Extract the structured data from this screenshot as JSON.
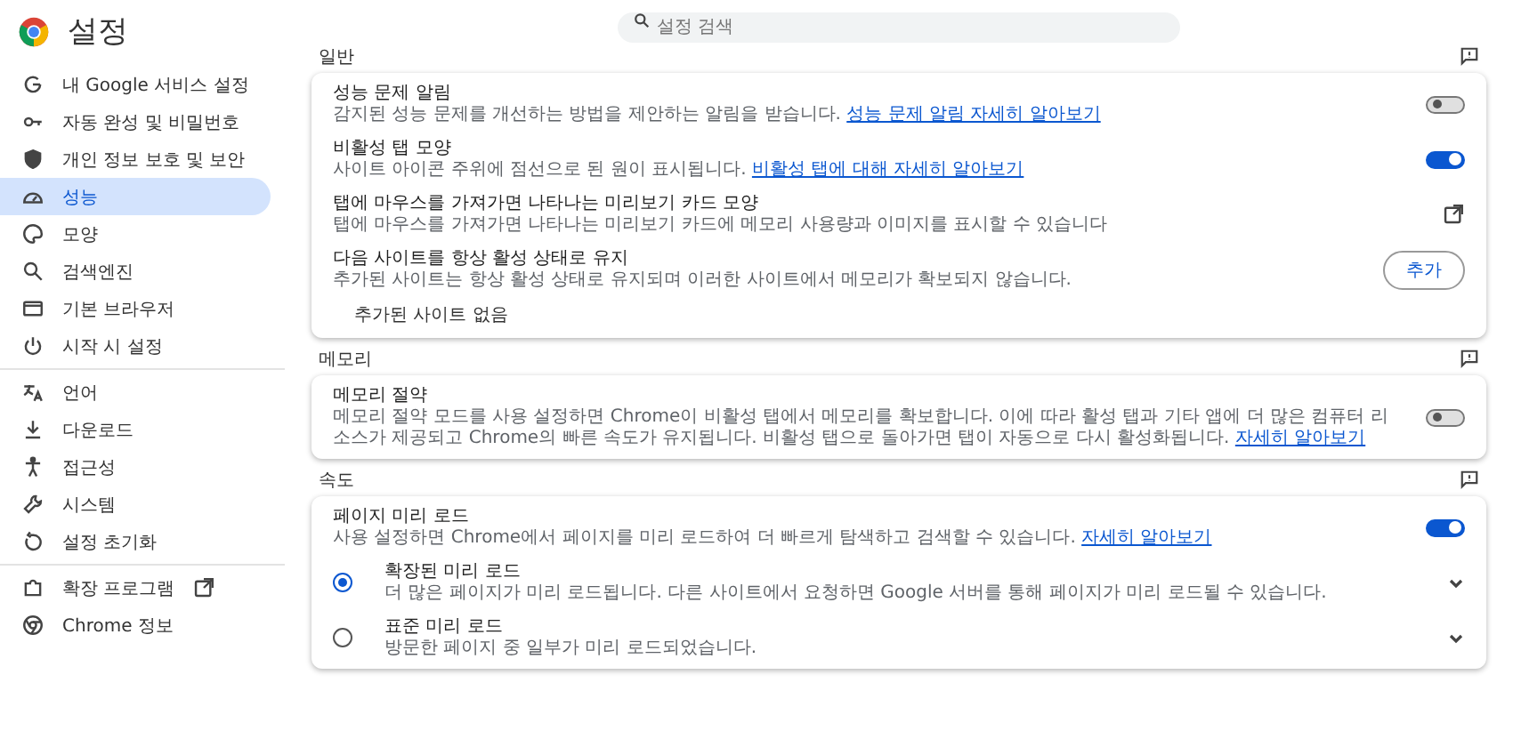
{
  "sidebar": {
    "title": "설정",
    "groups": [
      {
        "items": [
          {
            "label": "내 Google 서비스 설정",
            "selected": false
          },
          {
            "label": "자동 완성 및 비밀번호",
            "selected": false
          },
          {
            "label": "개인 정보 보호 및 보안",
            "selected": false
          },
          {
            "label": "성능",
            "selected": true
          },
          {
            "label": "모양",
            "selected": false
          },
          {
            "label": "검색엔진",
            "selected": false
          },
          {
            "label": "기본 브라우저",
            "selected": false
          },
          {
            "label": "시작 시 설정",
            "selected": false
          }
        ]
      },
      {
        "items": [
          {
            "label": "언어",
            "selected": false
          },
          {
            "label": "다운로드",
            "selected": false
          },
          {
            "label": "접근성",
            "selected": false
          },
          {
            "label": "시스템",
            "selected": false
          },
          {
            "label": "설정 초기화",
            "selected": false
          }
        ]
      },
      {
        "items": [
          {
            "label": "확장 프로그램",
            "selected": false,
            "external": true
          },
          {
            "label": "Chrome 정보",
            "selected": false
          }
        ]
      }
    ]
  },
  "search": {
    "placeholder": "설정 검색"
  },
  "sections": [
    {
      "title": "일반",
      "rows": [
        {
          "kind": "toggle",
          "title": "성능 문제 알림",
          "description": "감지된 성능 문제를 개선하는 방법을 제안하는 알림을 받습니다.",
          "link": "성능 문제 알림 자세히 알아보기",
          "on": false
        },
        {
          "kind": "toggle",
          "title": "비활성 탭 모양",
          "description": "사이트 아이콘 주위에 점선으로 된 원이 표시됩니다.",
          "link": "비활성 탭에 대해 자세히 알아보기",
          "on": true
        },
        {
          "kind": "external",
          "title": "탭에 마우스를 가져가면 나타나는 미리보기 카드 모양",
          "description": "탭에 마우스를 가져가면 나타나는 미리보기 카드에 메모리 사용량과 이미지를 표시할 수 있습니다"
        },
        {
          "kind": "button",
          "title": "다음 사이트를 항상 활성 상태로 유지",
          "description": "추가된 사이트는 항상 활성 상태로 유지되며 이러한 사이트에서 메모리가 확보되지 않습니다.",
          "button": "추가"
        },
        {
          "kind": "note",
          "title": "추가된 사이트 없음"
        }
      ]
    },
    {
      "title": "메모리",
      "rows": [
        {
          "kind": "toggle",
          "title": "메모리 절약",
          "description": "메모리 절약 모드를 사용 설정하면 Chrome이 비활성 탭에서 메모리를 확보합니다. 이에 따라 활성 탭과 기타 앱에 더 많은 컴퓨터 리소스가 제공되고 Chrome의 빠른 속도가 유지됩니다. 비활성 탭으로 돌아가면 탭이 자동으로 다시 활성화됩니다.",
          "link": "자세히 알아보기",
          "on": false
        }
      ]
    },
    {
      "title": "속도",
      "rows": [
        {
          "kind": "toggle",
          "title": "페이지 미리 로드",
          "description": "사용 설정하면 Chrome에서 페이지를 미리 로드하여 더 빠르게 탐색하고 검색할 수 있습니다.",
          "link": "자세히 알아보기",
          "on": true
        },
        {
          "kind": "radio",
          "title": "확장된 미리 로드",
          "description": "더 많은 페이지가 미리 로드됩니다. 다른 사이트에서 요청하면 Google 서버를 통해 페이지가 미리 로드될 수 있습니다.",
          "selected": true
        },
        {
          "kind": "radio",
          "title": "표준 미리 로드",
          "description": "방문한 페이지 중 일부가 미리 로드되었습니다.",
          "selected": false
        }
      ]
    }
  ]
}
